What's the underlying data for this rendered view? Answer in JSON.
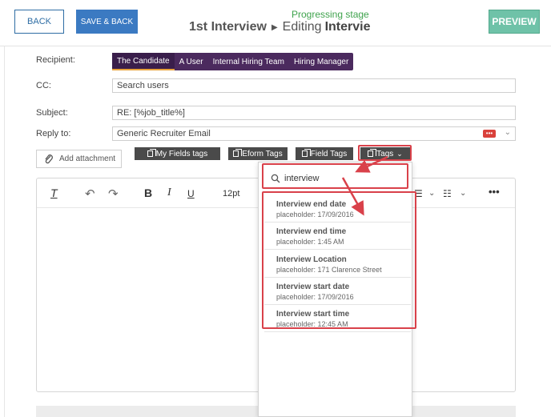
{
  "header": {
    "back_label": "BACK",
    "save_back_label": "SAVE & BACK",
    "stage_label": "Progressing stage",
    "crumb_1": "1st Interview",
    "crumb_2": "Editing",
    "crumb_3": "Intervie",
    "preview_label": "PREVIEW"
  },
  "form": {
    "recipient_label": "Recipient:",
    "recipient_tabs": [
      "The Candidate",
      "A User",
      "Internal Hiring Team",
      "Hiring Manager"
    ],
    "cc_label": "CC:",
    "cc_placeholder": "Search users",
    "subject_label": "Subject:",
    "subject_value": "RE: [%job_title%]",
    "reply_label": "Reply to:",
    "reply_value": "Generic Recruiter Email",
    "reply_badge": "•••"
  },
  "actions": {
    "attach_label": "Add attachment",
    "my_fields_tags": "My Fields tags",
    "eform_tags": "Eform Tags",
    "field_tags": "Field Tags",
    "tags": "Tags"
  },
  "editor": {
    "font_size": "12pt"
  },
  "dropdown": {
    "search_value": "interview",
    "items": [
      {
        "title": "Interview end date",
        "placeholder": "placeholder: 17/09/2016"
      },
      {
        "title": "Interview end time",
        "placeholder": "placeholder: 1:45 AM"
      },
      {
        "title": "Interview Location",
        "placeholder": "placeholder: 171 Clarence Street"
      },
      {
        "title": "Interview start date",
        "placeholder": "placeholder: 17/09/2016"
      },
      {
        "title": "Interview start time",
        "placeholder": "placeholder: 12:45 AM"
      }
    ]
  },
  "colors": {
    "primary": "#3b7ac2",
    "preview": "#6fc2a8",
    "stage": "#3fa34d",
    "recipient_bar": "#4b2a5e",
    "highlight": "#d9414a"
  }
}
